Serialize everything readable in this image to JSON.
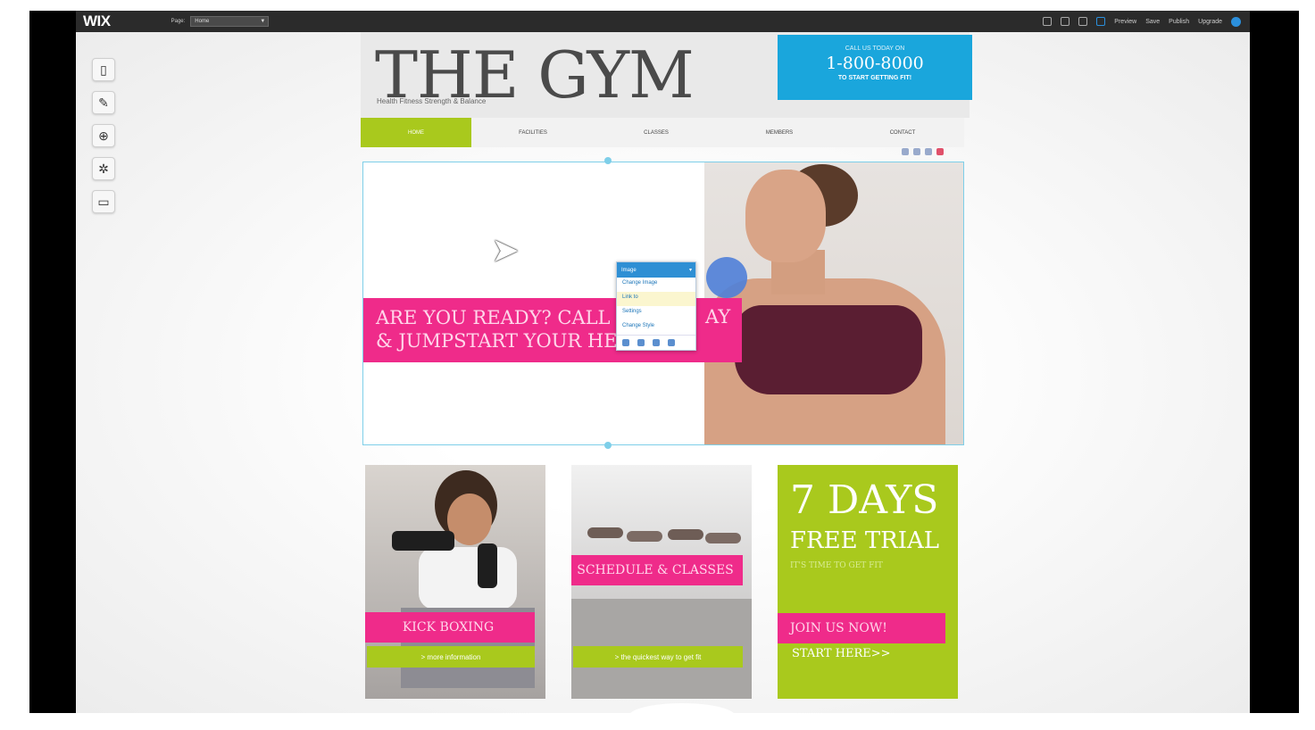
{
  "editor": {
    "logo": "WIX",
    "page_label": "Page:",
    "page_select_value": "Home",
    "top_links": [
      "Preview",
      "Save",
      "Publish",
      "Upgrade"
    ],
    "left_tools": [
      "page-icon",
      "design-icon",
      "add-icon",
      "settings-icon",
      "panel-icon"
    ]
  },
  "site": {
    "title": "THE GYM",
    "tagline": "Health Fitness Strength & Balance",
    "cta": {
      "line1": "CALL US TODAY ON",
      "line2": "1-800-8000",
      "line3": "TO START GETTING FIT!"
    },
    "nav": [
      "HOME",
      "FACILITIES",
      "CLASSES",
      "MEMBERS",
      "CONTACT"
    ],
    "hero_banner_line1": "ARE YOU READY? CALL",
    "hero_banner_line2": "& JUMPSTART YOUR HEA",
    "hero_banner_right": "AY"
  },
  "context_menu": {
    "title": "Image",
    "items": [
      "Change Image",
      "Link to",
      "Settings",
      "Change Style"
    ]
  },
  "cards": [
    {
      "band": "KICK BOXING",
      "sub": "> more information"
    },
    {
      "band": "SCHEDULE & CLASSES",
      "sub": "> the quickest way to get fit"
    },
    {
      "heading1": "7 DAYS",
      "heading2": "FREE TRIAL",
      "small": "IT'S TIME TO GET FIT",
      "band": "JOIN US NOW!",
      "cta": "START HERE>>"
    }
  ],
  "colors": {
    "pink": "#ef2b8a",
    "lime": "#a9c91d",
    "blue": "#1aa6dc",
    "editor_bar": "#2b2b2b"
  }
}
